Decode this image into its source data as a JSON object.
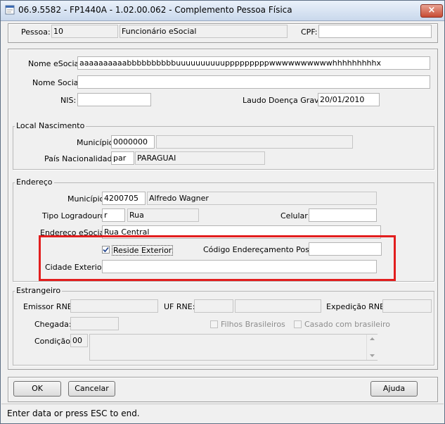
{
  "window": {
    "title": "06.9.5582 - FP1440A - 1.02.00.062 - Complemento Pessoa Física",
    "close_label": "×"
  },
  "header": {
    "pessoa_label": "Pessoa:",
    "pessoa_value": "10",
    "tipo_value": "Funcionário eSocial",
    "cpf_label": "CPF:",
    "cpf_value": ""
  },
  "main": {
    "nome_esocial_label": "Nome eSocial:",
    "nome_esocial_value": "aaaaaaaaaabbbbbbbbbbuuuuuuuuuupppppppppwwwwwwwwwwhhhhhhhhhx",
    "nome_social_label": "Nome Social:",
    "nome_social_value": "",
    "nis_label": "NIS:",
    "nis_value": "",
    "laudo_label": "Laudo Doença Grave:",
    "laudo_value": "20/01/2010"
  },
  "nascimento": {
    "legend": "Local Nascimento",
    "municipio_label": "Município:",
    "municipio_code": "0000000",
    "municipio_name": "",
    "pais_label": "País Nacionalidade:",
    "pais_code": "par",
    "pais_name": "PARAGUAI"
  },
  "endereco": {
    "legend": "Endereço",
    "municipio_label": "Município:",
    "municipio_code": "4200705",
    "municipio_name": "Alfredo Wagner",
    "tipo_label": "Tipo Logradouro:",
    "tipo_code": "r",
    "tipo_name": "Rua",
    "celular_label": "Celular:",
    "celular_value": "",
    "endereco_label": "Endereço eSocial:",
    "endereco_value": "Rua Central",
    "reside_label": "Reside Exterior",
    "reside_checked": true,
    "codigo_postal_label": "Código Endereçamento Postal:",
    "codigo_postal_value": "",
    "cidade_exterior_label": "Cidade Exterior:",
    "cidade_exterior_value": ""
  },
  "estrangeiro": {
    "legend": "Estrangeiro",
    "emissor_label": "Emissor RNE:",
    "emissor_value": "",
    "uf_label": "UF RNE:",
    "uf_value": "",
    "uf_name": "",
    "expedicao_label": "Expedição RNE:",
    "expedicao_value": "",
    "chegada_label": "Chegada:",
    "chegada_value": "",
    "filhos_label": "Filhos Brasileiros",
    "casado_label": "Casado com brasileiro",
    "condicao_label": "Condição:",
    "condicao_code": "00",
    "condicao_text": ""
  },
  "buttons": {
    "ok": "OK",
    "cancelar": "Cancelar",
    "ajuda": "Ajuda"
  },
  "status": {
    "text": "Enter data or press ESC to end."
  },
  "colors": {
    "highlight": "#e21e1e",
    "titlebar": "#c9d8ec"
  },
  "icons": {
    "app": "app-window-icon",
    "check": "check-mark",
    "scroll_up": "triangle-up",
    "scroll_down": "triangle-down"
  }
}
